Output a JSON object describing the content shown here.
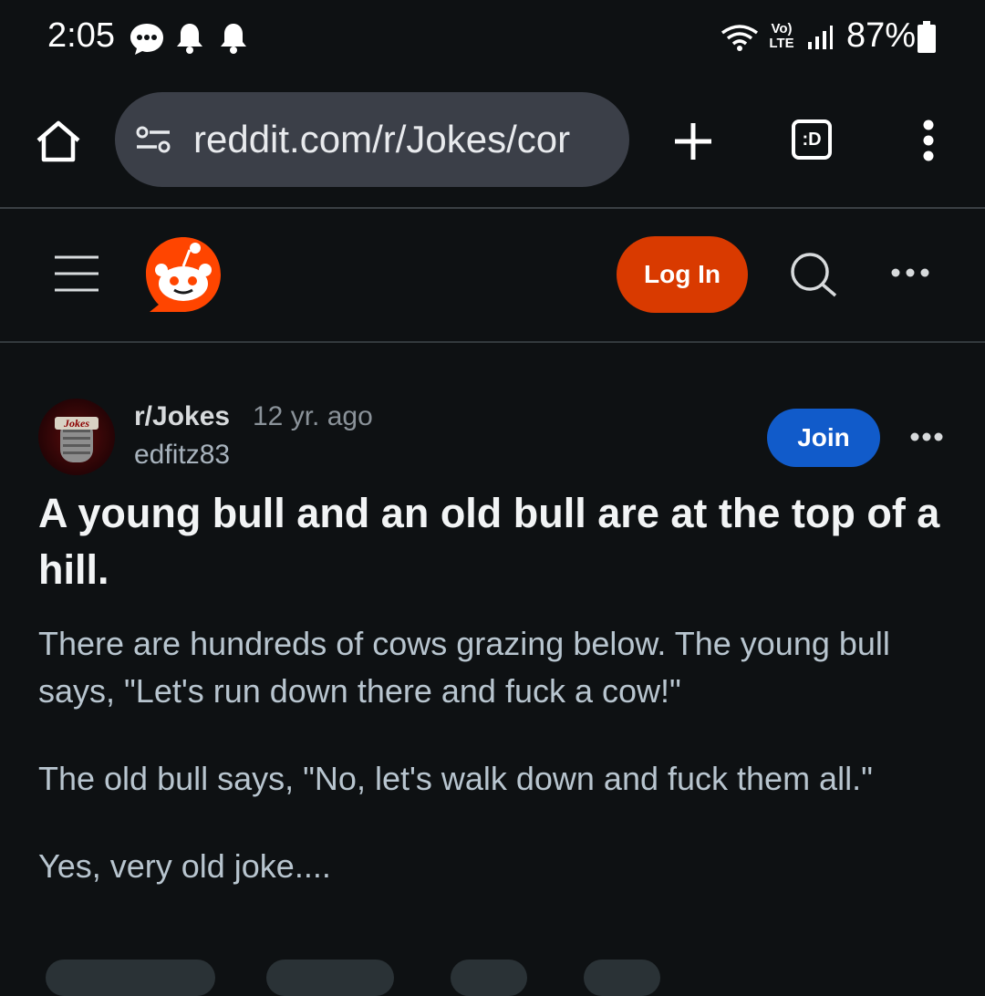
{
  "status_bar": {
    "time": "2:05",
    "battery": "87%",
    "network_label": "Vo) LTE",
    "icons": [
      "message-icon",
      "bell-icon",
      "bell-icon",
      "wifi-icon",
      "signal-icon",
      "battery-icon"
    ]
  },
  "browser": {
    "url": "reddit.com/r/Jokes/cor",
    "tab_switcher_label": ":D",
    "icons": [
      "home-icon",
      "site-settings-icon",
      "new-tab-icon",
      "tab-switcher-icon",
      "overflow-menu-icon"
    ]
  },
  "reddit_header": {
    "login_label": "Log In",
    "icons": [
      "hamburger-menu-icon",
      "reddit-logo-icon",
      "search-icon",
      "more-icon"
    ]
  },
  "post": {
    "subreddit": "r/Jokes",
    "age": "12 yr. ago",
    "author": "edfitz83",
    "join_label": "Join",
    "avatar_text": "Jokes",
    "title": "A young bull and an old bull are at the top of a hill.",
    "body": [
      "There are hundreds of cows grazing below. The young bull says, \"Let's run down there and fuck a cow!\"",
      "The old bull says, \"No, let's walk down and fuck them all.\"",
      "Yes, very old joke...."
    ]
  },
  "colors": {
    "background": "#0e1113",
    "login_button": "#d93a00",
    "join_button": "#115bca",
    "reddit_orange": "#ff4500",
    "url_bar": "#3b3f48"
  }
}
